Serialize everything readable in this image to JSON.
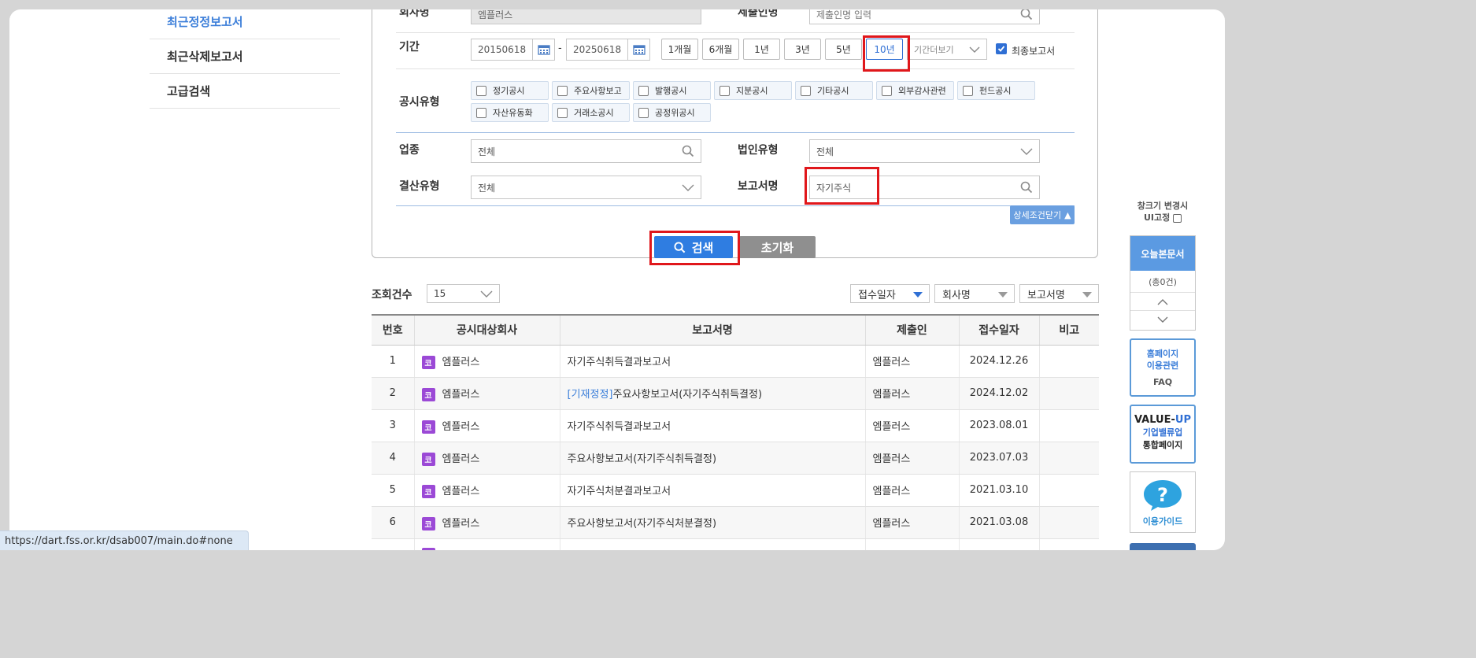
{
  "nav": {
    "items": [
      {
        "label": "최근정정보고서",
        "active": true
      },
      {
        "label": "최근삭제보고서",
        "active": false
      },
      {
        "label": "고급검색",
        "active": false
      }
    ]
  },
  "search": {
    "company_label": "회사명",
    "company_value": "엠플러스",
    "submitter_label": "제출인명",
    "submitter_placeholder": "제출인명 입력",
    "period_label": "기간",
    "date_from": "20150618",
    "date_sep": "-",
    "date_to": "20250618",
    "period_buttons": [
      "1개월",
      "6개월",
      "1년",
      "3년",
      "5년",
      "10년"
    ],
    "period_selected": "10년",
    "period_more": "기간더보기",
    "final_report_label": "최종보고서",
    "final_report_checked": true,
    "type_label": "공시유형",
    "types_row1": [
      "정기공시",
      "주요사항보고",
      "발행공시",
      "지분공시",
      "기타공시",
      "외부감사관련",
      "펀드공시"
    ],
    "types_row2": [
      "자산유동화",
      "거래소공시",
      "공정위공시"
    ],
    "industry_label": "업종",
    "industry_value": "전체",
    "corp_type_label": "법인유형",
    "corp_type_value": "전체",
    "settle_label": "결산유형",
    "settle_value": "전체",
    "report_name_label": "보고서명",
    "report_name_value": "자기주식",
    "detail_close": "상세조건닫기",
    "search_button": "검색",
    "reset_button": "초기화"
  },
  "results": {
    "count_label": "조회건수",
    "count_value": "15",
    "sort": [
      "접수일자",
      "회사명",
      "보고서명"
    ],
    "columns": [
      "번호",
      "공시대상회사",
      "보고서명",
      "제출인",
      "접수일자",
      "비고"
    ],
    "corp_badge": "코",
    "rows": [
      {
        "no": "1",
        "company": "엠플러스",
        "tag": "",
        "report": "자기주식취득결과보고서",
        "submitter": "엠플러스",
        "date": "2024.12.26",
        "note": ""
      },
      {
        "no": "2",
        "company": "엠플러스",
        "tag": "[기재정정]",
        "report": "주요사항보고서(자기주식취득결정)",
        "submitter": "엠플러스",
        "date": "2024.12.02",
        "note": ""
      },
      {
        "no": "3",
        "company": "엠플러스",
        "tag": "",
        "report": "자기주식취득결과보고서",
        "submitter": "엠플러스",
        "date": "2023.08.01",
        "note": ""
      },
      {
        "no": "4",
        "company": "엠플러스",
        "tag": "",
        "report": "주요사항보고서(자기주식취득결정)",
        "submitter": "엠플러스",
        "date": "2023.07.03",
        "note": ""
      },
      {
        "no": "5",
        "company": "엠플러스",
        "tag": "",
        "report": "자기주식처분결과보고서",
        "submitter": "엠플러스",
        "date": "2021.03.10",
        "note": ""
      },
      {
        "no": "6",
        "company": "엠플러스",
        "tag": "",
        "report": "주요사항보고서(자기주식처분결정)",
        "submitter": "엠플러스",
        "date": "2021.03.08",
        "note": ""
      }
    ]
  },
  "side": {
    "fix_label_1": "창크기 변경시",
    "fix_label_2": "UI고정",
    "today_title": "오늘본문서",
    "today_count": "(총0건)",
    "faq_line1": "홈페이지",
    "faq_line2": "이용관련",
    "faq_line3": "FAQ",
    "value_line1a": "VALUE-",
    "value_line1b": "UP",
    "value_line2": "기업밸류업",
    "value_line3": "통합페이지",
    "guide_label": "이용가이드"
  },
  "status_url": "https://dart.fss.or.kr/dsab007/main.do#none"
}
